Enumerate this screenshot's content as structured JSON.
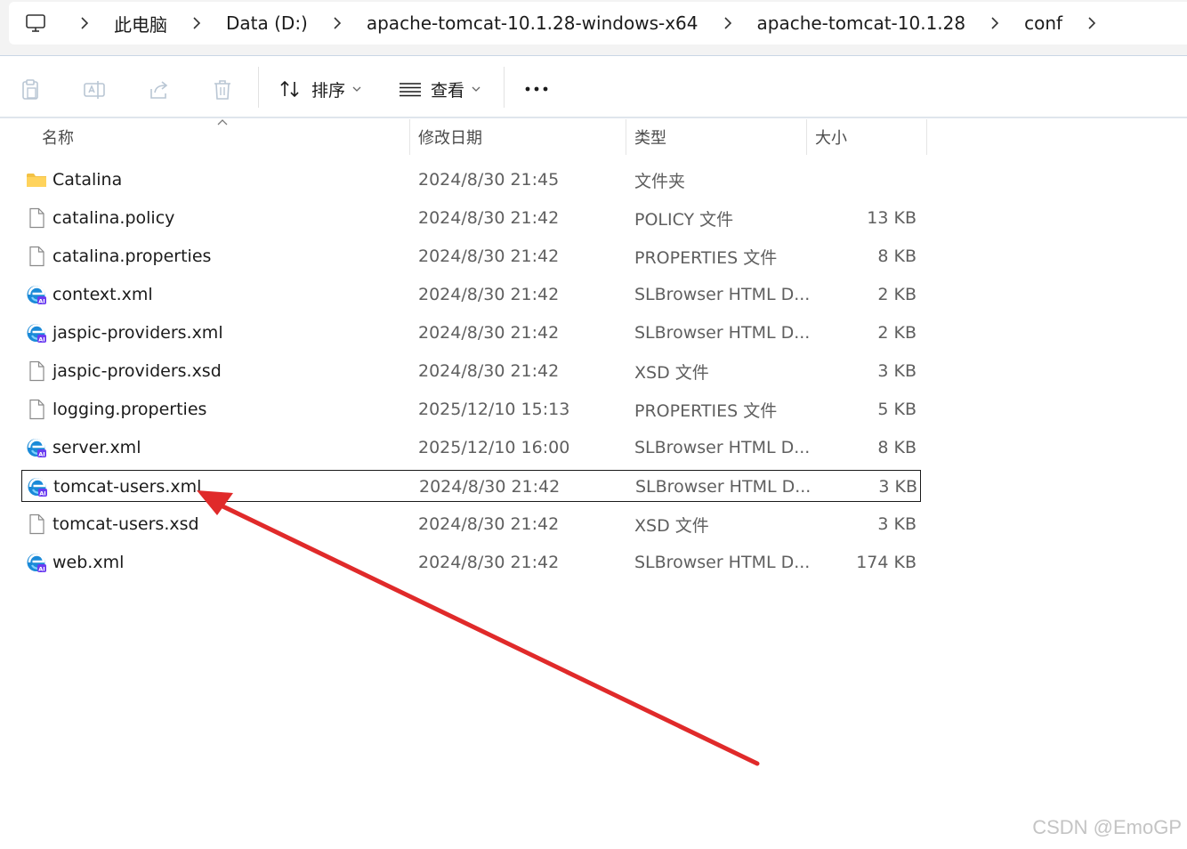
{
  "breadcrumb": [
    "此电脑",
    "Data (D:)",
    "apache-tomcat-10.1.28-windows-x64",
    "apache-tomcat-10.1.28",
    "conf"
  ],
  "toolbar": {
    "sort_label": "排序",
    "view_label": "查看",
    "more_label": "..."
  },
  "columns": {
    "name": "名称",
    "date": "修改日期",
    "type": "类型",
    "size": "大小"
  },
  "files": [
    {
      "name": "Catalina",
      "date": "2024/8/30 21:45",
      "type": "文件夹",
      "size": "",
      "icon": "folder-icon"
    },
    {
      "name": "catalina.policy",
      "date": "2024/8/30 21:42",
      "type": "POLICY 文件",
      "size": "13 KB",
      "icon": "file-icon"
    },
    {
      "name": "catalina.properties",
      "date": "2024/8/30 21:42",
      "type": "PROPERTIES 文件",
      "size": "8 KB",
      "icon": "file-icon"
    },
    {
      "name": "context.xml",
      "date": "2024/8/30 21:42",
      "type": "SLBrowser HTML D...",
      "size": "2 KB",
      "icon": "browser-icon"
    },
    {
      "name": "jaspic-providers.xml",
      "date": "2024/8/30 21:42",
      "type": "SLBrowser HTML D...",
      "size": "2 KB",
      "icon": "browser-icon"
    },
    {
      "name": "jaspic-providers.xsd",
      "date": "2024/8/30 21:42",
      "type": "XSD 文件",
      "size": "3 KB",
      "icon": "file-icon"
    },
    {
      "name": "logging.properties",
      "date": "2025/12/10 15:13",
      "type": "PROPERTIES 文件",
      "size": "5 KB",
      "icon": "file-icon"
    },
    {
      "name": "server.xml",
      "date": "2025/12/10 16:00",
      "type": "SLBrowser HTML D...",
      "size": "8 KB",
      "icon": "browser-icon"
    },
    {
      "name": "tomcat-users.xml",
      "date": "2024/8/30 21:42",
      "type": "SLBrowser HTML D...",
      "size": "3 KB",
      "icon": "browser-icon",
      "selected": true
    },
    {
      "name": "tomcat-users.xsd",
      "date": "2024/8/30 21:42",
      "type": "XSD 文件",
      "size": "3 KB",
      "icon": "file-icon"
    },
    {
      "name": "web.xml",
      "date": "2024/8/30 21:42",
      "type": "SLBrowser HTML D...",
      "size": "174 KB",
      "icon": "browser-icon"
    }
  ],
  "annotation": {
    "color": "#e02a2a"
  },
  "watermark": "CSDN @EmoGP"
}
